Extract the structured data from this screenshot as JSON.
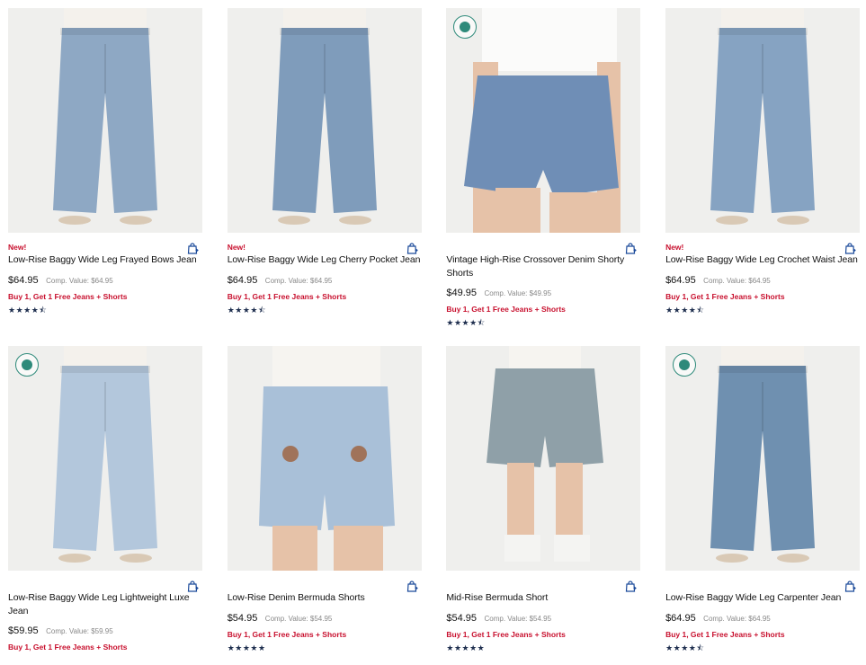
{
  "products": [
    {
      "is_new": true,
      "new_label": "New!",
      "title": "Low-Rise Baggy Wide Leg Frayed Bows Jean",
      "price": "$64.95",
      "comp": "Comp. Value: $64.95",
      "promo": "Buy 1, Get 1 Free Jeans + Shorts",
      "rating": 4.5,
      "stars": "★★★★⯪",
      "badge": false,
      "style": "jeans",
      "wash": "#8ea8c4"
    },
    {
      "is_new": true,
      "new_label": "New!",
      "title": "Low-Rise Baggy Wide Leg Cherry Pocket Jean",
      "price": "$64.95",
      "comp": "Comp. Value: $64.95",
      "promo": "Buy 1, Get 1 Free Jeans + Shorts",
      "rating": 4.5,
      "stars": "★★★★⯪",
      "badge": false,
      "style": "jeans",
      "wash": "#7f9cbb"
    },
    {
      "is_new": false,
      "new_label": "",
      "title": "Vintage High-Rise Crossover Denim Shorty Shorts",
      "price": "$49.95",
      "comp": "Comp. Value: $49.95",
      "promo": "Buy 1, Get 1 Free Jeans + Shorts",
      "rating": 4.5,
      "stars": "★★★★⯪",
      "badge": true,
      "style": "shorty",
      "wash": "#6f8eb6"
    },
    {
      "is_new": true,
      "new_label": "New!",
      "title": "Low-Rise Baggy Wide Leg Crochet Waist Jean",
      "price": "$64.95",
      "comp": "Comp. Value: $64.95",
      "promo": "Buy 1, Get 1 Free Jeans + Shorts",
      "rating": 4.5,
      "stars": "★★★★⯪",
      "badge": false,
      "style": "jeans",
      "wash": "#86a3c2"
    },
    {
      "is_new": false,
      "new_label": "",
      "title": "Low-Rise Baggy Wide Leg Lightweight Luxe Jean",
      "price": "$59.95",
      "comp": "Comp. Value: $59.95",
      "promo": "Buy 1, Get 1 Free Jeans + Shorts",
      "rating": null,
      "stars": "",
      "badge": true,
      "style": "jeans",
      "wash": "#b3c7dc"
    },
    {
      "is_new": false,
      "new_label": "",
      "title": "Low-Rise Denim Bermuda Shorts",
      "price": "$54.95",
      "comp": "Comp. Value: $54.95",
      "promo": "Buy 1, Get 1 Free Jeans + Shorts",
      "rating": 5,
      "stars": "★★★★★",
      "badge": false,
      "style": "bermuda-back",
      "wash": "#a9c0d8"
    },
    {
      "is_new": false,
      "new_label": "",
      "title": "Mid-Rise Bermuda Short",
      "price": "$54.95",
      "comp": "Comp. Value: $54.95",
      "promo": "Buy 1, Get 1 Free Jeans + Shorts",
      "rating": 5,
      "stars": "★★★★★",
      "badge": false,
      "style": "bermuda",
      "wash": "#8fa0a8"
    },
    {
      "is_new": false,
      "new_label": "",
      "title": "Low-Rise Baggy Wide Leg Carpenter Jean",
      "price": "$64.95",
      "comp": "Comp. Value: $64.95",
      "promo": "Buy 1, Get 1 Free Jeans + Shorts",
      "rating": 4.5,
      "stars": "★★★★⯪",
      "badge": true,
      "style": "jeans",
      "wash": "#6f90b0"
    }
  ],
  "icons": {
    "bag": "shopping-bag-plus-icon",
    "badge": "earth-globe-badge-icon",
    "star": "star-icon"
  },
  "colors": {
    "accent_red": "#c8102e",
    "star_navy": "#1f2f4f",
    "badge_teal": "#2e8a7a"
  }
}
